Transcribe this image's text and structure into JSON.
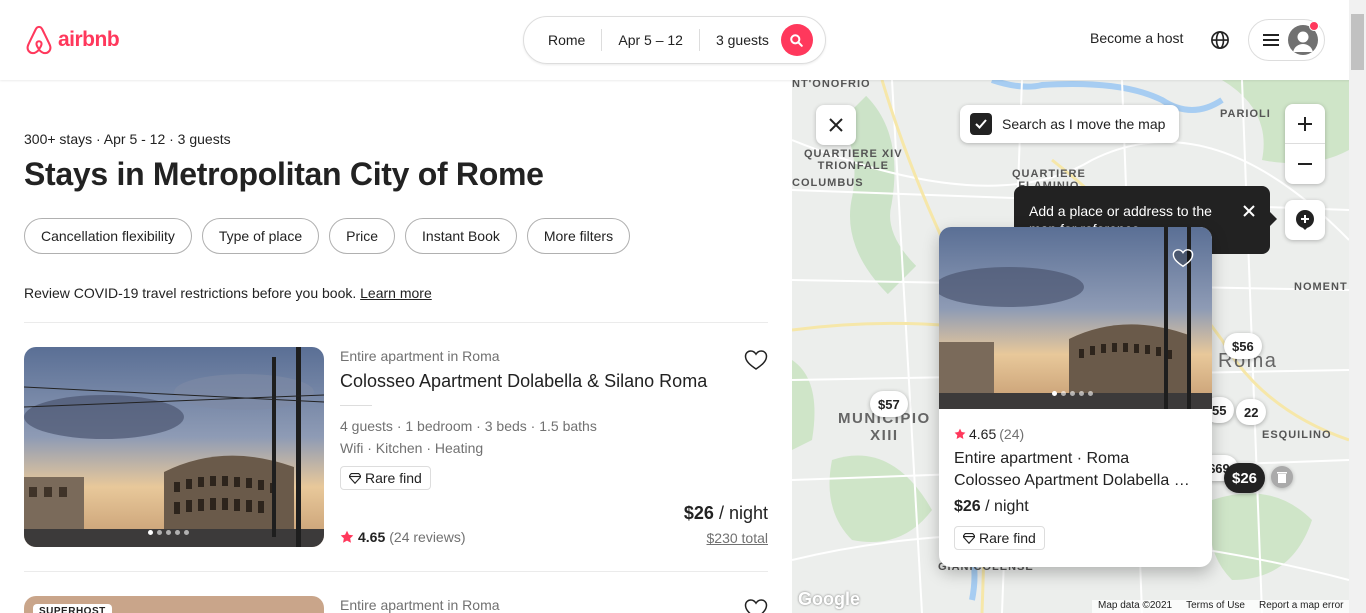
{
  "header": {
    "brand": "airbnb",
    "search": {
      "location": "Rome",
      "dates": "Apr 5 – 12",
      "guests": "3 guests"
    },
    "become_host": "Become a host"
  },
  "results": {
    "meta": "300+ stays · Apr 5 - 12 · 3 guests",
    "title": "Stays in Metropolitan City of Rome",
    "filters": [
      "Cancellation flexibility",
      "Type of place",
      "Price",
      "Instant Book",
      "More filters"
    ],
    "covid_text": "Review COVID-19 travel restrictions before you book.",
    "covid_link": "Learn more"
  },
  "listings": [
    {
      "type": "Entire apartment in Roma",
      "title": "Colosseo Apartment Dolabella & Silano Roma",
      "details1": "4 guests · 1 bedroom · 3 beds · 1.5 baths",
      "details2": "Wifi · Kitchen · Heating",
      "badge": "Rare find",
      "rating": "4.65",
      "reviews": "(24 reviews)",
      "price": "$26",
      "per": "/ night",
      "total": "$230 total"
    },
    {
      "type": "Entire apartment in Roma",
      "badge": "SUPERHOST"
    }
  ],
  "map": {
    "search_as_move": "Search as I move the map",
    "tooltip": "Add a place or address to the map for reference.",
    "pins": [
      "$57",
      "$56",
      "55",
      "22",
      "$69",
      "$26"
    ],
    "card": {
      "rating": "4.65",
      "count": "(24)",
      "line1": "Entire apartment · Roma",
      "line2": "Colosseo Apartment Dolabella & Silano Roma",
      "price": "$26",
      "per": "/ night",
      "badge": "Rare find"
    },
    "labels": {
      "onofrio": "NT'ONOFRIO",
      "parioli": "PARIOLI",
      "trionfale": "QUARTIERE XIV\nTRIONFALE",
      "flaminio": "QUARTIERE\nFLAMINIO",
      "columbus": "COLUMBUS",
      "nomentano": "NOMENT",
      "municipio": "MUNICIPIO\nXIII",
      "esquilino": "ESQUILINO",
      "roma": "Roma",
      "gianicolense": "GIANICOLENSE"
    },
    "footer": [
      "Map data ©2021",
      "Terms of Use",
      "Report a map error"
    ],
    "google": "Google"
  }
}
